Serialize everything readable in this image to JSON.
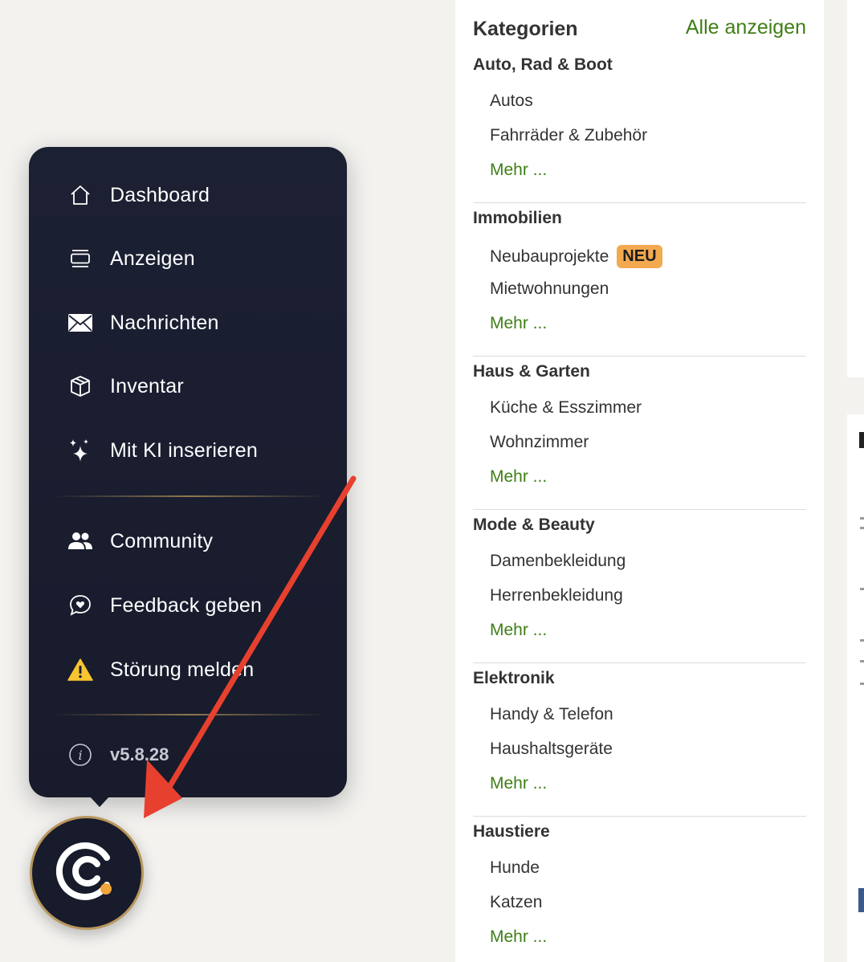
{
  "categories": {
    "title": "Kategorien",
    "show_all": "Alle anzeigen",
    "groups": [
      {
        "title": "Auto, Rad & Boot",
        "items": [
          "Autos",
          "Fahrräder & Zubehör"
        ],
        "more": "Mehr ..."
      },
      {
        "title": "Immobilien",
        "items": [
          "Neubauprojekte",
          "Mietwohnungen"
        ],
        "badge": "NEU",
        "more": "Mehr ..."
      },
      {
        "title": "Haus & Garten",
        "items": [
          "Küche & Esszimmer",
          "Wohnzimmer"
        ],
        "more": "Mehr ..."
      },
      {
        "title": "Mode & Beauty",
        "items": [
          "Damenbekleidung",
          "Herrenbekleidung"
        ],
        "more": "Mehr ..."
      },
      {
        "title": "Elektronik",
        "items": [
          "Handy & Telefon",
          "Haushaltsgeräte"
        ],
        "more": "Mehr ..."
      },
      {
        "title": "Haustiere",
        "items": [
          "Hunde",
          "Katzen"
        ],
        "more": "Mehr ..."
      }
    ]
  },
  "menu": {
    "items": [
      {
        "label": "Dashboard",
        "icon": "home-icon"
      },
      {
        "label": "Anzeigen",
        "icon": "listings-icon"
      },
      {
        "label": "Nachrichten",
        "icon": "envelope-icon"
      },
      {
        "label": "Inventar",
        "icon": "box-icon"
      },
      {
        "label": "Mit KI inserieren",
        "icon": "sparkles-icon"
      },
      {
        "label": "Community",
        "icon": "people-icon"
      },
      {
        "label": "Feedback geben",
        "icon": "heart-chat-icon"
      },
      {
        "label": "Störung melden",
        "icon": "warning-icon"
      }
    ],
    "version": "v5.8.28",
    "version_icon": "info-icon"
  },
  "logo": {
    "icon": "app-logo-icon"
  },
  "annotation": {
    "icon": "red-arrow",
    "color": "#e8402f"
  },
  "colors": {
    "accent_green": "#3f7f16",
    "badge_orange": "#f2a950",
    "menu_bg": "#1c2033",
    "gold": "#b8975c"
  }
}
